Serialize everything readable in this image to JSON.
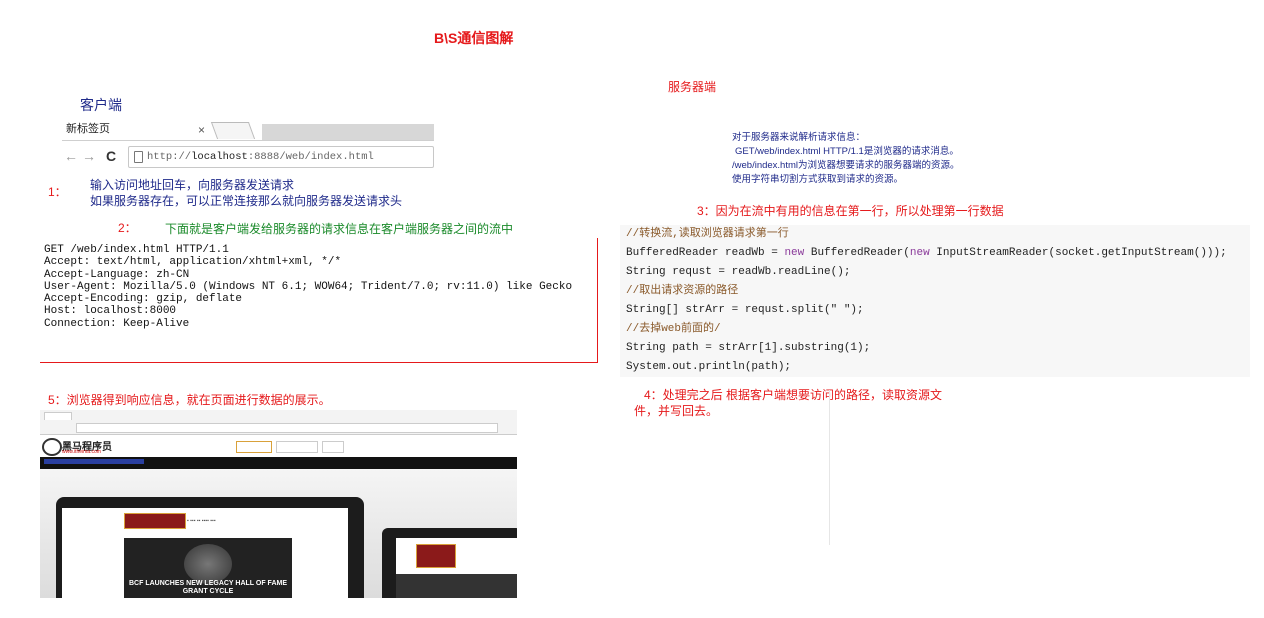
{
  "title": "B\\S通信图解",
  "server_title": "服务器端",
  "client_title": "客户端",
  "browser": {
    "tab_label": "新标签页",
    "tab_close": "×",
    "back": "←",
    "forward": "→",
    "reload": "C",
    "url_prefix": "http://",
    "url_host": "localhost",
    "url_rest": ":8888/web/index.html"
  },
  "step1": {
    "num": "1：",
    "line1": "输入访问地址回车，向服务器发送请求",
    "line2": "如果服务器存在，可以正常连接那么就向服务器发送请求头"
  },
  "step2": {
    "num": "2：",
    "text": "下面就是客户端发给服务器的请求信息在客户端服务器之间的流中"
  },
  "request_lines": [
    "GET /web/index.html HTTP/1.1",
    "Accept: text/html, application/xhtml+xml, */*",
    "Accept-Language: zh-CN",
    "User-Agent: Mozilla/5.0 (Windows NT 6.1; WOW64; Trident/7.0; rv:11.0) like Gecko",
    "Accept-Encoding: gzip, deflate",
    "Host: localhost:8000",
    "Connection: Keep-Alive"
  ],
  "step5": "5：浏览器得到响应信息，就在页面进行数据的展示。",
  "site": {
    "logo": "黑马程序员",
    "logo_sub": "www.itheima.com",
    "slide_caption": "BCF LAUNCHES NEW LEGACY HALL OF FAME",
    "slide_caption2": "GRANT CYCLE"
  },
  "server_desc": [
    "对于服务器来说解析请求信息：",
    "GET/web/index.html HTTP/1.1是浏览器的请求消息。",
    "/web/index.html为浏览器想要请求的服务器端的资源。",
    "使用字符串切割方式获取到请求的资源。"
  ],
  "step3": "3：因为在流中有用的信息在第一行，所以处理第一行数据",
  "code": {
    "c1": "//转换流,读取浏览器请求第一行",
    "l2a": "BufferedReader readWb = ",
    "l2kw": "new",
    "l2b": " BufferedReader(",
    "l2kw2": "new",
    "l2c": " InputStreamReader(socket.getInputStream()));",
    "l3": "String requst = readWb.readLine();",
    "c4": "//取出请求资源的路径",
    "l5": "String[] strArr = requst.split(\" \");",
    "c6": "//去掉web前面的/",
    "l7": "String path = strArr[1].substring(1);",
    "l8": "System.out.println(path);"
  },
  "step4": {
    "line1": "4：处理完之后 根据客户端想要访问的路径，读取资源文",
    "line2": "件，并写回去。"
  },
  "colors": {
    "accent_red": "#e5191b",
    "text_blue": "#1f2a8a",
    "text_green": "#1a8a2a"
  }
}
